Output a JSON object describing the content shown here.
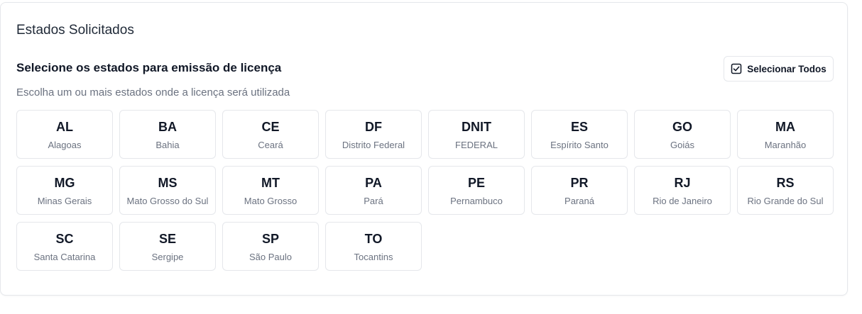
{
  "card": {
    "title": "Estados Solicitados"
  },
  "section": {
    "title": "Selecione os estados para emissão de licença",
    "subtitle": "Escolha um ou mais estados onde a licença será utilizada",
    "select_all_label": "Selecionar Todos",
    "select_all_icon": "checkbox-square-icon"
  },
  "states": [
    {
      "code": "AL",
      "name": "Alagoas"
    },
    {
      "code": "BA",
      "name": "Bahia"
    },
    {
      "code": "CE",
      "name": "Ceará"
    },
    {
      "code": "DF",
      "name": "Distrito Federal"
    },
    {
      "code": "DNIT",
      "name": "FEDERAL"
    },
    {
      "code": "ES",
      "name": "Espírito Santo"
    },
    {
      "code": "GO",
      "name": "Goiás"
    },
    {
      "code": "MA",
      "name": "Maranhão"
    },
    {
      "code": "MG",
      "name": "Minas Gerais"
    },
    {
      "code": "MS",
      "name": "Mato Grosso do Sul"
    },
    {
      "code": "MT",
      "name": "Mato Grosso"
    },
    {
      "code": "PA",
      "name": "Pará"
    },
    {
      "code": "PE",
      "name": "Pernambuco"
    },
    {
      "code": "PR",
      "name": "Paraná"
    },
    {
      "code": "RJ",
      "name": "Rio de Janeiro"
    },
    {
      "code": "RS",
      "name": "Rio Grande do Sul"
    },
    {
      "code": "SC",
      "name": "Santa Catarina"
    },
    {
      "code": "SE",
      "name": "Sergipe"
    },
    {
      "code": "SP",
      "name": "São Paulo"
    },
    {
      "code": "TO",
      "name": "Tocantins"
    }
  ],
  "colors": {
    "border": "#e5e7eb",
    "text_primary": "#111827",
    "text_muted": "#6b7280"
  }
}
